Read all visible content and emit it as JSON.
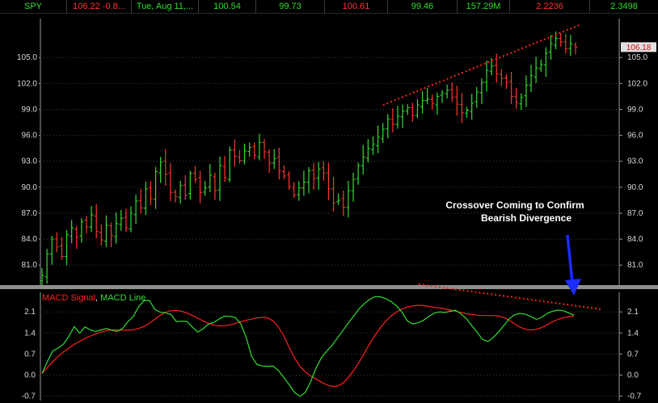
{
  "quote_bar": {
    "symbol": "SPY",
    "last": "106.22",
    "change": "-0.8...",
    "date": "Tue, Aug 11,...",
    "open": "100.54",
    "low": "99.73",
    "high": "100.61",
    "prev": "99.46",
    "volume": "157.29M",
    "stat1": "2.2236",
    "stat2": "2.3498"
  },
  "colors": {
    "up": "#33dd33",
    "down": "#ff3333",
    "background": "#000000",
    "grid": "#3c3c3c",
    "annotation_arrow": "#1a2cff",
    "trendline": "#ff2020"
  },
  "chart_data": [
    {
      "type": "ohlc",
      "ylim": [
        78.5,
        109.5
      ],
      "yticks": [
        "81.0",
        "84.0",
        "87.0",
        "90.0",
        "93.0",
        "96.0",
        "99.0",
        "102.0",
        "105.0"
      ],
      "last_price_label": "106.18",
      "grid": true,
      "trendline_label": "",
      "closes": [
        79.8,
        82.3,
        84.0,
        83.1,
        82.0,
        84.5,
        85.3,
        84.2,
        86.0,
        85.4,
        86.8,
        84.9,
        83.9,
        85.6,
        84.4,
        85.8,
        86.4,
        85.3,
        87.0,
        88.4,
        87.6,
        89.8,
        88.7,
        91.8,
        92.9,
        91.5,
        89.4,
        88.9,
        90.2,
        89.1,
        91.6,
        90.9,
        89.4,
        89.9,
        91.4,
        89.6,
        92.5,
        91.1,
        94.3,
        93.6,
        93.1,
        94.2,
        94.6,
        93.7,
        95.2,
        94.1,
        92.8,
        93.3,
        91.9,
        91.3,
        90.1,
        89.1,
        89.9,
        90.6,
        91.9,
        91.0,
        92.1,
        91.6,
        89.8,
        88.2,
        88.5,
        87.7,
        89.6,
        90.9,
        92.5,
        93.5,
        94.5,
        95.0,
        95.8,
        96.7,
        97.9,
        97.3,
        98.2,
        98.8,
        99.2,
        98.3,
        99.5,
        100.0,
        100.2,
        99.7,
        100.5,
        100.9,
        101.2,
        100.4,
        99.6,
        98.6,
        98.9,
        99.7,
        101.0,
        102.1,
        103.5,
        104.0,
        103.1,
        102.6,
        102.1,
        100.5,
        99.8,
        100.4,
        101.8,
        102.9,
        103.8,
        104.2,
        105.5,
        106.6,
        107.2,
        106.8,
        106.0,
        106.6,
        106.2
      ]
    },
    {
      "type": "line",
      "title": "",
      "ylim": [
        -0.85,
        2.75
      ],
      "yticks": [
        "-0.7",
        "0.0",
        "0.7",
        "1.4",
        "2.1"
      ],
      "grid": true,
      "series": [
        {
          "name": "MACD Signal",
          "color": "#ff2020",
          "values": [
            0.05,
            0.25,
            0.45,
            0.62,
            0.77,
            0.9,
            1.02,
            1.12,
            1.22,
            1.3,
            1.37,
            1.43,
            1.48,
            1.5,
            1.5,
            1.49,
            1.49,
            1.51,
            1.55,
            1.62,
            1.72,
            1.86,
            1.99,
            2.09,
            2.14,
            2.15,
            2.12,
            2.06,
            1.98,
            1.89,
            1.8,
            1.72,
            1.66,
            1.63,
            1.64,
            1.67,
            1.72,
            1.77,
            1.82,
            1.86,
            1.9,
            1.92,
            1.9,
            1.8,
            1.6,
            1.3,
            0.92,
            0.56,
            0.29,
            0.1,
            -0.03,
            -0.13,
            -0.24,
            -0.33,
            -0.38,
            -0.37,
            -0.27,
            -0.08,
            0.15,
            0.42,
            0.73,
            1.04,
            1.33,
            1.58,
            1.8,
            1.97,
            2.1,
            2.2,
            2.26,
            2.3,
            2.32,
            2.31,
            2.28,
            2.25,
            2.23,
            2.2,
            2.16,
            2.12,
            2.08,
            2.04,
            2.01,
            1.99,
            1.98,
            1.98,
            1.98,
            1.96,
            1.91,
            1.82,
            1.7,
            1.59,
            1.52,
            1.5,
            1.52,
            1.58,
            1.67,
            1.77,
            1.85,
            1.91,
            1.94,
            1.96
          ]
        },
        {
          "name": "MACD Line",
          "color": "#33dd33",
          "values": [
            0.05,
            0.45,
            0.8,
            0.9,
            1.03,
            1.29,
            1.61,
            1.39,
            1.6,
            1.5,
            1.45,
            1.5,
            1.55,
            1.49,
            1.45,
            1.55,
            1.78,
            1.95,
            2.28,
            2.48,
            2.48,
            2.18,
            2.09,
            2.07,
            2.01,
            1.78,
            1.79,
            1.78,
            1.59,
            1.43,
            1.54,
            1.7,
            1.75,
            1.87,
            1.96,
            1.95,
            1.91,
            1.7,
            1.25,
            0.62,
            0.35,
            0.3,
            0.29,
            0.3,
            0.15,
            -0.08,
            -0.32,
            -0.58,
            -0.71,
            -0.58,
            -0.22,
            0.23,
            0.58,
            0.8,
            0.99,
            1.24,
            1.48,
            1.73,
            1.96,
            2.2,
            2.38,
            2.52,
            2.61,
            2.6,
            2.54,
            2.44,
            2.3,
            2.09,
            1.8,
            1.7,
            1.74,
            1.82,
            1.95,
            2.06,
            2.1,
            2.08,
            2.12,
            2.15,
            2.03,
            1.87,
            1.64,
            1.42,
            1.18,
            1.12,
            1.25,
            1.44,
            1.66,
            1.88,
            2.01,
            2.05,
            2.02,
            1.95,
            1.85,
            1.92,
            2.05,
            2.12,
            2.16,
            2.14,
            2.07,
            1.99
          ]
        }
      ]
    }
  ],
  "annotation": {
    "line1": "Crossover Coming to Confirm",
    "line2": "Bearish Divergence"
  }
}
